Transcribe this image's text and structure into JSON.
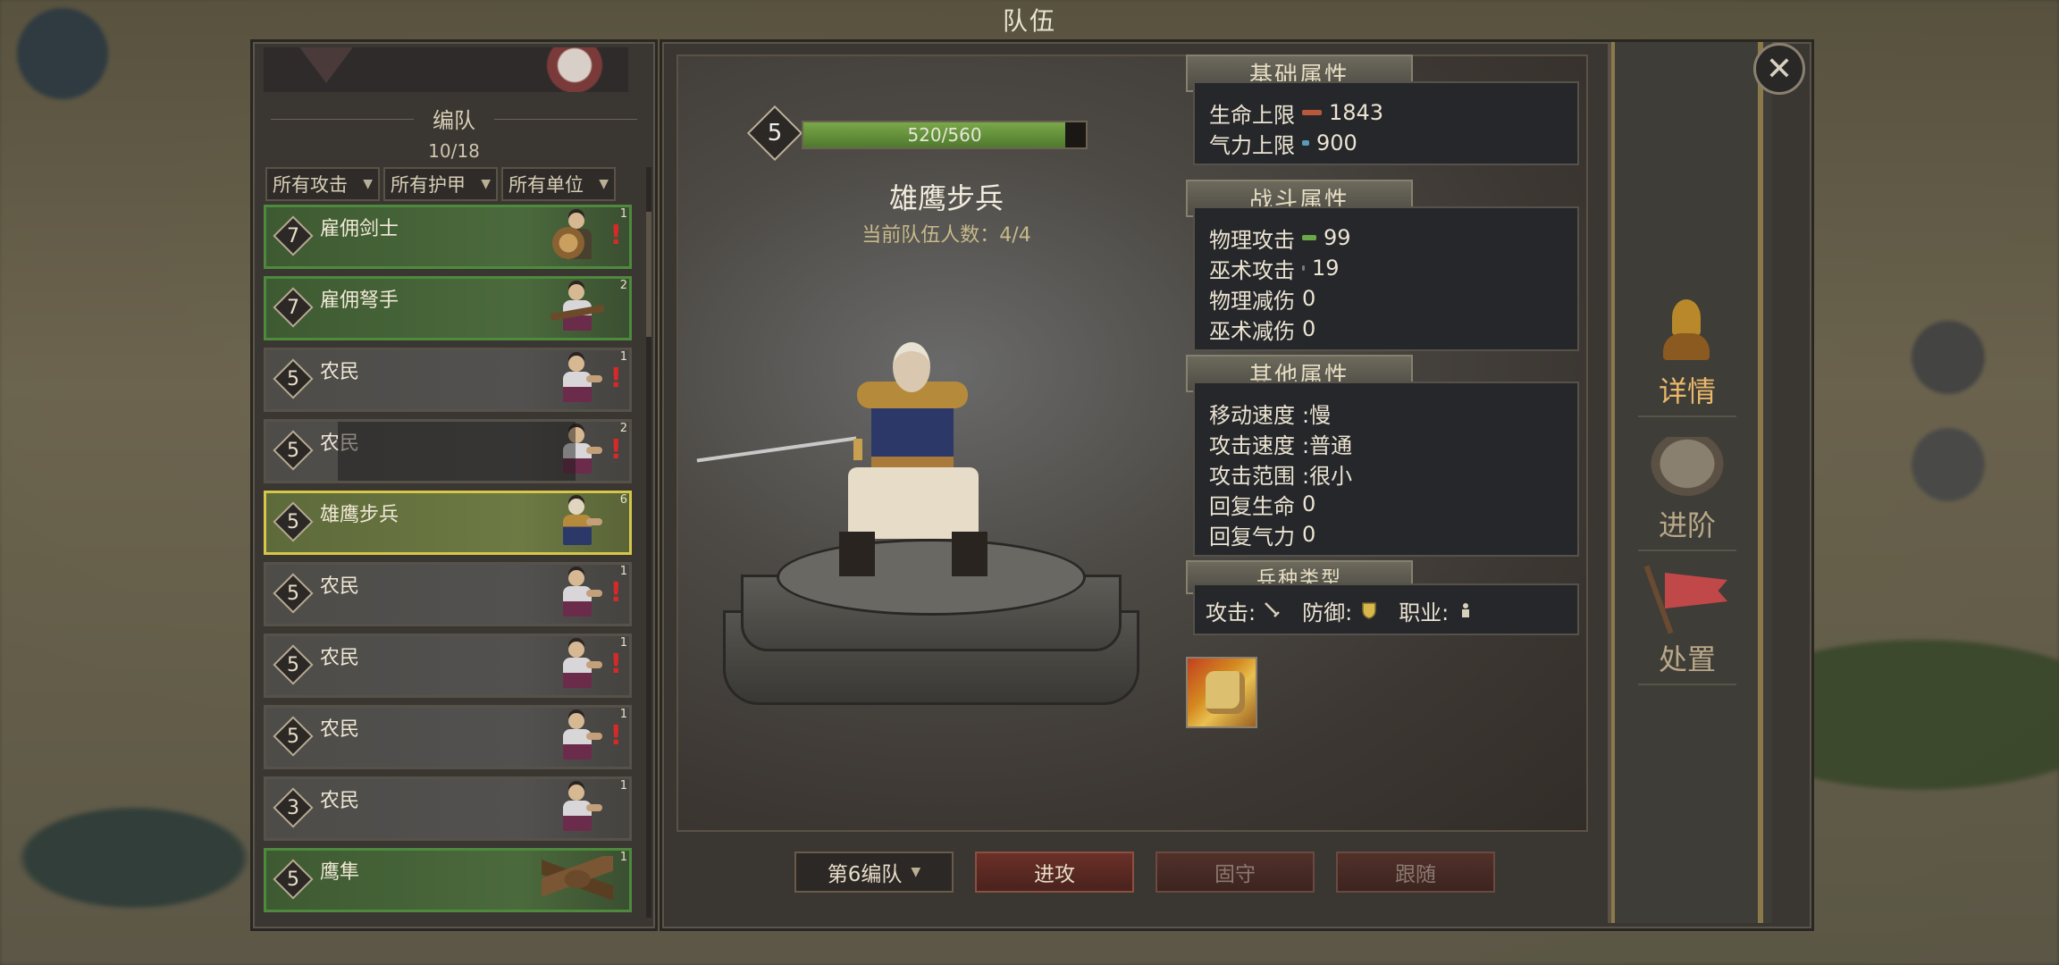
{
  "window": {
    "title": "队伍"
  },
  "roster": {
    "section_label": "编队",
    "count": "10/18",
    "filters": [
      {
        "label": "所有攻击"
      },
      {
        "label": "所有护甲"
      },
      {
        "label": "所有单位"
      }
    ],
    "units": [
      {
        "level": "7",
        "name": "雇佣剑士",
        "tier": "1",
        "warning": "!",
        "style": "green",
        "portrait": "swordsman"
      },
      {
        "level": "7",
        "name": "雇佣弩手",
        "tier": "2",
        "warning": "",
        "style": "green",
        "portrait": "crossbow"
      },
      {
        "level": "5",
        "name": "农民",
        "tier": "1",
        "warning": "!",
        "style": "gray",
        "portrait": "peasant"
      },
      {
        "level": "5",
        "name": "农民",
        "tier": "2",
        "warning": "!",
        "style": "gray dim",
        "portrait": "peasant"
      },
      {
        "level": "5",
        "name": "雄鹰步兵",
        "tier": "6",
        "warning": "",
        "style": "selected",
        "portrait": "eagle-infantry"
      },
      {
        "level": "5",
        "name": "农民",
        "tier": "1",
        "warning": "!",
        "style": "gray",
        "portrait": "peasant"
      },
      {
        "level": "5",
        "name": "农民",
        "tier": "1",
        "warning": "!",
        "style": "gray",
        "portrait": "peasant"
      },
      {
        "level": "5",
        "name": "农民",
        "tier": "1",
        "warning": "!",
        "style": "gray",
        "portrait": "peasant"
      },
      {
        "level": "3",
        "name": "农民",
        "tier": "1",
        "warning": "",
        "style": "gray",
        "portrait": "peasant"
      },
      {
        "level": "5",
        "name": "鹰隼",
        "tier": "1",
        "warning": "",
        "style": "green",
        "portrait": "eagle"
      }
    ]
  },
  "unit_detail": {
    "level": "5",
    "hp_text": "520/560",
    "hp_fraction": 0.9286,
    "name": "雄鹰步兵",
    "troop_count_text": "当前队伍人数：4/4"
  },
  "attributes": {
    "basic": {
      "header": "基础属性",
      "rows": [
        {
          "label": "生命上限",
          "value": "1843",
          "bar_color": "#b85a3a"
        },
        {
          "label": "气力上限",
          "value": "900",
          "bar_color": "#5a9ab8"
        }
      ]
    },
    "combat": {
      "header": "战斗属性",
      "rows": [
        {
          "label": "物理攻击",
          "value": "99",
          "bar_color": "#6aa84a"
        },
        {
          "label": "巫术攻击",
          "value": "19",
          "bar_color": "#7a7a7a"
        },
        {
          "label": "物理减伤",
          "value": "0"
        },
        {
          "label": "巫术减伤",
          "value": "0"
        }
      ]
    },
    "other": {
      "header": "其他属性",
      "rows": [
        {
          "label": "移动速度",
          "value": ":慢"
        },
        {
          "label": "攻击速度",
          "value": ":普通"
        },
        {
          "label": "攻击范围",
          "value": ":很小"
        },
        {
          "label": "回复生命",
          "value": "0"
        },
        {
          "label": "回复气力",
          "value": "0"
        }
      ]
    },
    "troop_type": {
      "header": "兵种类型",
      "attack_label": "攻击:",
      "defense_label": "防御:",
      "class_label": "职业:",
      "attack_icon": "sword-icon",
      "defense_icon": "shield-icon",
      "class_icon": "infantry-icon"
    }
  },
  "skill": {
    "icon": "fist-icon"
  },
  "bottom_bar": {
    "squad_select": "第6编队",
    "attack_btn": "进攻",
    "hold_btn": "固守",
    "follow_btn": "跟随"
  },
  "side_tabs": [
    {
      "label": "详情",
      "active": true
    },
    {
      "label": "进阶",
      "active": false
    },
    {
      "label": "处置",
      "active": false
    }
  ],
  "colors": {
    "accent": "#e9b86a",
    "selected_border": "#d6c64a",
    "warning": "#d42a2a",
    "hp": "#6aa84a"
  }
}
